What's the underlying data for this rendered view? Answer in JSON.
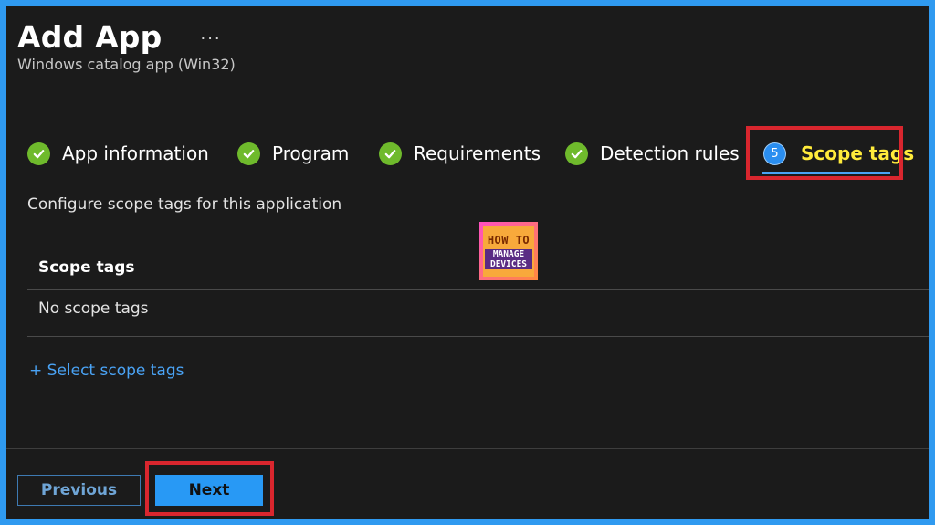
{
  "header": {
    "title": "Add App",
    "more_label": "···",
    "subtitle": "Windows catalog app (Win32)"
  },
  "wizard": {
    "steps": [
      {
        "label": "App information",
        "status": "complete",
        "icon": "check-icon"
      },
      {
        "label": "Program",
        "status": "complete",
        "icon": "check-icon"
      },
      {
        "label": "Requirements",
        "status": "complete",
        "icon": "check-icon"
      },
      {
        "label": "Detection rules",
        "status": "complete",
        "icon": "check-icon"
      },
      {
        "label": "Scope tags",
        "status": "active",
        "number": "5"
      }
    ]
  },
  "content": {
    "description": "Configure scope tags for this application",
    "table_header": "Scope tags",
    "empty_row": "No scope tags",
    "select_link": "+ Select scope tags"
  },
  "logo": {
    "line1": "HOW TO",
    "line2": "MANAGE",
    "line3": "DEVICES"
  },
  "footer": {
    "previous_label": "Previous",
    "next_label": "Next"
  },
  "colors": {
    "background": "#1b1b1b",
    "frame_border": "#2f9af0",
    "check_green": "#6fba2c",
    "accent_blue": "#2899f5",
    "active_label": "#ffeb3b",
    "highlight_red": "#d9262e"
  }
}
